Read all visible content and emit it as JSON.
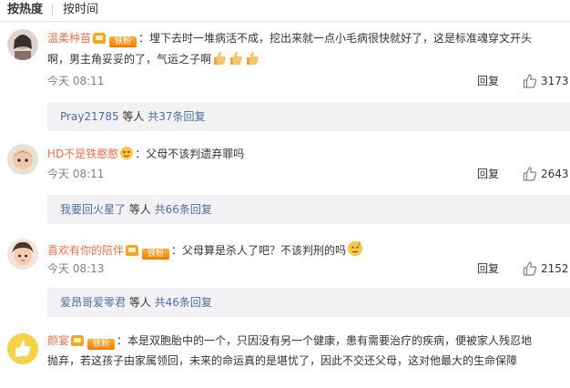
{
  "sort": {
    "hot": "按热度",
    "time": "按时间"
  },
  "comments": [
    {
      "username": "温柔种苗",
      "badge_fan": "铁粉",
      "text_line1": "：埋下去时一堆病活不成，挖出来就一点小毛病很快就好了，这是标准魂穿文开头",
      "text_line2": "啊，男主角妥妥的了，气运之子啊",
      "emojis": [
        "thumbs-up",
        "thumbs-up",
        "thumbs-up"
      ],
      "time": "今天 08:11",
      "reply_label": "回复",
      "likes": "3173",
      "sub_users": "Pray21785",
      "sub_mid": " 等人 ",
      "sub_count": "共37条回复"
    },
    {
      "username": "HD不是铁憨憨",
      "text_line1": "：父母不该判遗弃罪吗",
      "time": "今天 08:11",
      "reply_label": "回复",
      "likes": "2643",
      "sub_users": "我要回火星了",
      "sub_mid": " 等人 ",
      "sub_count": "共66条回复"
    },
    {
      "username": "喜欢有你的陪伴",
      "badge_fan": "铁粉",
      "text_line1": "：父母算是杀人了吧？不该判刑的吗",
      "emojis": [
        "thinking"
      ],
      "time": "今天 08:13",
      "reply_label": "回复",
      "likes": "2152",
      "sub_users": "爱昂哥爱零君",
      "sub_mid": " 等人 ",
      "sub_count": "共46条回复"
    },
    {
      "username": "颜宴",
      "badge_fan": "铁粉",
      "text_line1": "：本是双胞胎中的一个，只因没有另一个健康，患有需要治疗的疾病，便被家人残忍地",
      "text_line2": "抛弃，若这孩子由家属领回，未来的命运真的是堪忧了，因此不交还父母，这对他最大的生命保障"
    }
  ],
  "colors": {
    "username": "#eb7350",
    "link": "#4b6f9f",
    "meta": "#808080",
    "sub_bg": "#f2f2f5",
    "like": "#808080"
  }
}
